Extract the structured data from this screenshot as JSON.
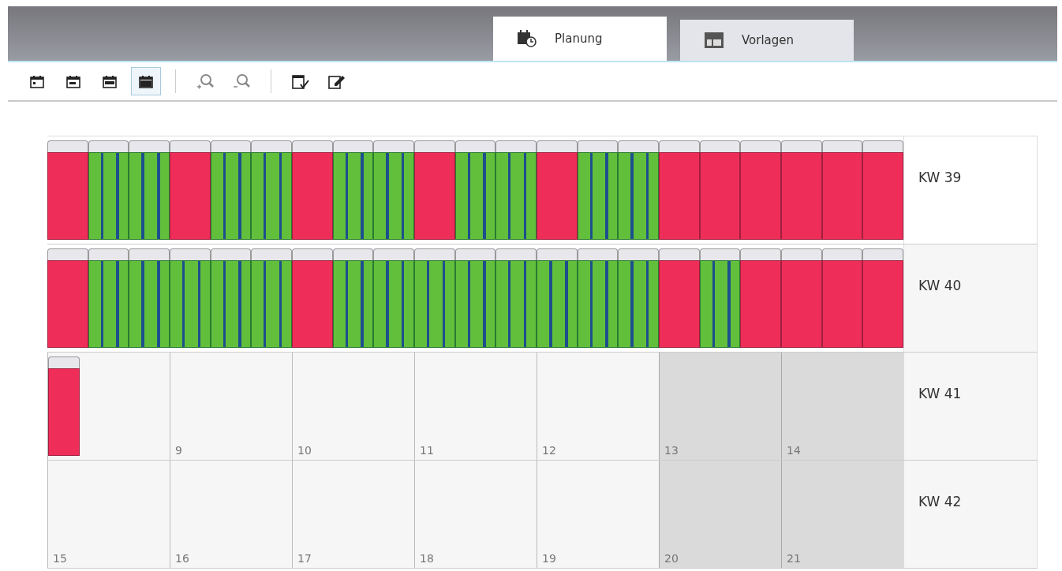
{
  "tabs": [
    {
      "label": "Planung",
      "selected": true
    },
    {
      "label": "Vorlagen",
      "selected": false
    }
  ],
  "toolbar": {
    "view_buttons": [
      {
        "selected": false
      },
      {
        "selected": false
      },
      {
        "selected": false
      },
      {
        "selected": true
      }
    ]
  },
  "weeks": [
    {
      "label": "KW 39",
      "events": [
        {
          "kind": "busy"
        },
        {
          "kind": "free"
        },
        {
          "kind": "free"
        },
        {
          "kind": "busy"
        },
        {
          "kind": "free"
        },
        {
          "kind": "free"
        },
        {
          "kind": "busy"
        },
        {
          "kind": "free"
        },
        {
          "kind": "free"
        },
        {
          "kind": "busy"
        },
        {
          "kind": "free"
        },
        {
          "kind": "free"
        },
        {
          "kind": "busy"
        },
        {
          "kind": "free"
        },
        {
          "kind": "free"
        },
        {
          "kind": "busy"
        },
        {
          "kind": "busy"
        },
        {
          "kind": "busy"
        },
        {
          "kind": "busy"
        },
        {
          "kind": "busy"
        },
        {
          "kind": "busy"
        }
      ]
    },
    {
      "label": "KW 40",
      "events": [
        {
          "kind": "busy"
        },
        {
          "kind": "free"
        },
        {
          "kind": "free"
        },
        {
          "kind": "free"
        },
        {
          "kind": "free"
        },
        {
          "kind": "free"
        },
        {
          "kind": "busy"
        },
        {
          "kind": "free"
        },
        {
          "kind": "free"
        },
        {
          "kind": "free"
        },
        {
          "kind": "free"
        },
        {
          "kind": "free"
        },
        {
          "kind": "free"
        },
        {
          "kind": "free"
        },
        {
          "kind": "free"
        },
        {
          "kind": "busy"
        },
        {
          "kind": "free"
        },
        {
          "kind": "busy"
        },
        {
          "kind": "busy"
        },
        {
          "kind": "busy"
        },
        {
          "kind": "busy"
        }
      ]
    },
    {
      "label": "KW 41",
      "events": [
        {
          "kind": "busy"
        }
      ],
      "days": [
        {
          "weekend": false
        },
        {
          "number": "9",
          "weekend": false
        },
        {
          "number": "10",
          "weekend": false
        },
        {
          "number": "11",
          "weekend": false
        },
        {
          "number": "12",
          "weekend": false
        },
        {
          "number": "13",
          "weekend": true
        },
        {
          "number": "14",
          "weekend": true
        }
      ]
    },
    {
      "label": "KW 42",
      "days": [
        {
          "number": "15",
          "weekend": false
        },
        {
          "number": "16",
          "weekend": false
        },
        {
          "number": "17",
          "weekend": false
        },
        {
          "number": "18",
          "weekend": false
        },
        {
          "number": "19",
          "weekend": false
        },
        {
          "number": "20",
          "weekend": true
        },
        {
          "number": "21",
          "weekend": true
        }
      ]
    }
  ]
}
